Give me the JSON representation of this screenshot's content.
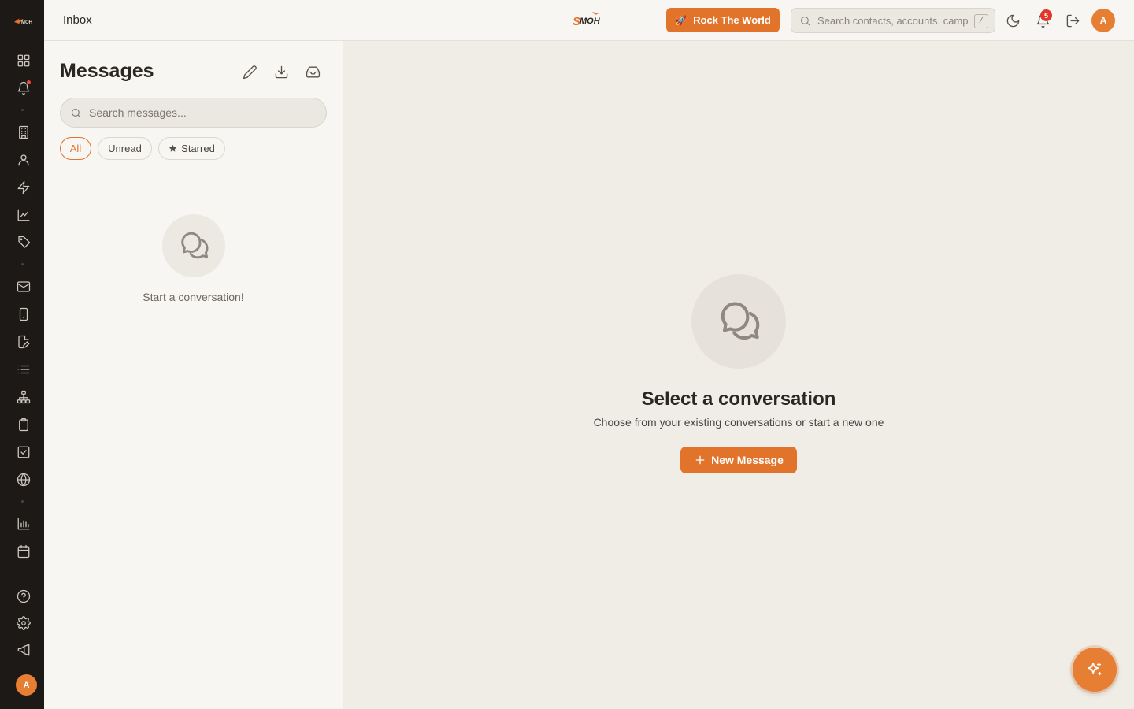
{
  "topbar": {
    "title": "Inbox",
    "brand_logo_text": "SMOH",
    "cta_label": "Rock The World",
    "search_placeholder": "Search contacts, accounts, campaigns...",
    "search_shortcut": "/",
    "notification_count": "5",
    "avatar_initial": "A"
  },
  "rail": {
    "avatar_initial": "A",
    "icons": [
      "dashboard-icon",
      "bell-icon",
      "building-icon",
      "user-icon",
      "lightning-icon",
      "trending-chart-icon",
      "tag-icon",
      "mail-icon",
      "phone-icon",
      "edit-document-icon",
      "list-icon",
      "sitemap-icon",
      "clipboard-icon",
      "checkbox-icon",
      "globe-icon",
      "bar-chart-icon",
      "calendar-icon",
      "help-icon",
      "settings-icon",
      "megaphone-icon"
    ]
  },
  "messages": {
    "title": "Messages",
    "search_placeholder": "Search messages...",
    "filters": [
      "All",
      "Unread",
      "Starred"
    ],
    "active_filter": "All",
    "empty_text": "Start a conversation!"
  },
  "main": {
    "title": "Select a conversation",
    "subtitle": "Choose from your existing conversations or start a new one",
    "button_label": "New Message"
  },
  "colors": {
    "accent": "#e2732a",
    "rail_bg": "#1c1917",
    "badge": "#e0362b"
  }
}
